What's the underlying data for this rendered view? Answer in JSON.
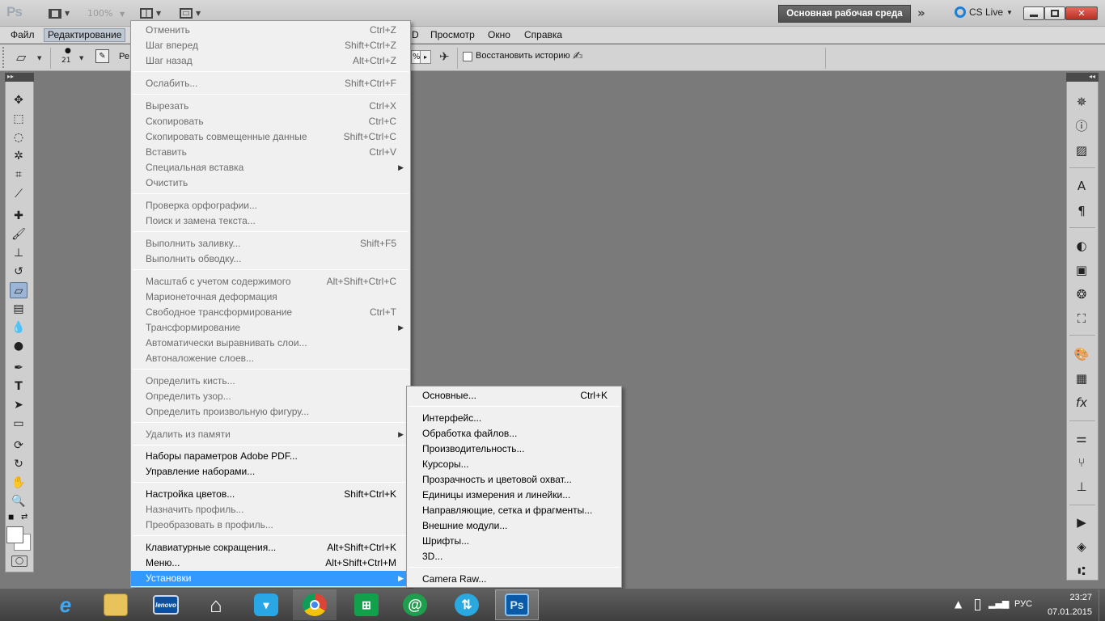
{
  "titlebar": {
    "app_logo": "Ps",
    "zoom": "100%",
    "workspace": "Основная рабочая среда",
    "more_workspaces": "»",
    "cs_live": "CS Live",
    "window_buttons": [
      "minimize-icon",
      "restore-icon",
      "close-icon"
    ]
  },
  "menubar": {
    "items": [
      "Файл",
      "Редактирование",
      "D",
      "Просмотр",
      "Окно",
      "Справка"
    ]
  },
  "options": {
    "brush_size": "21",
    "mode_prefix": "Ре",
    "percent_fragment": "%",
    "restore_history": "Восстановить историю"
  },
  "edit_menu": {
    "items": [
      {
        "label": "Отменить",
        "shortcut": "Ctrl+Z",
        "enabled": false
      },
      {
        "label": "Шаг вперед",
        "shortcut": "Shift+Ctrl+Z",
        "enabled": false
      },
      {
        "label": "Шаг назад",
        "shortcut": "Alt+Ctrl+Z",
        "enabled": false
      },
      {
        "label": "Ослабить...",
        "shortcut": "Shift+Ctrl+F",
        "enabled": false
      },
      {
        "label": "Вырезать",
        "shortcut": "Ctrl+X",
        "enabled": false
      },
      {
        "label": "Скопировать",
        "shortcut": "Ctrl+C",
        "enabled": false
      },
      {
        "label": "Скопировать совмещенные данные",
        "shortcut": "Shift+Ctrl+C",
        "enabled": false
      },
      {
        "label": "Вставить",
        "shortcut": "Ctrl+V",
        "enabled": false
      },
      {
        "label": "Специальная вставка",
        "shortcut": "",
        "enabled": false,
        "submenu": true
      },
      {
        "label": "Очистить",
        "shortcut": "",
        "enabled": false
      },
      {
        "label": "Проверка орфографии...",
        "shortcut": "",
        "enabled": false
      },
      {
        "label": "Поиск и замена текста...",
        "shortcut": "",
        "enabled": false
      },
      {
        "label": "Выполнить заливку...",
        "shortcut": "Shift+F5",
        "enabled": false
      },
      {
        "label": "Выполнить обводку...",
        "shortcut": "",
        "enabled": false
      },
      {
        "label": "Масштаб с учетом содержимого",
        "shortcut": "Alt+Shift+Ctrl+C",
        "enabled": false
      },
      {
        "label": "Марионеточная деформация",
        "shortcut": "",
        "enabled": false
      },
      {
        "label": "Свободное трансформирование",
        "shortcut": "Ctrl+T",
        "enabled": false
      },
      {
        "label": "Трансформирование",
        "shortcut": "",
        "enabled": false,
        "submenu": true
      },
      {
        "label": "Автоматически выравнивать слои...",
        "shortcut": "",
        "enabled": false
      },
      {
        "label": "Автоналожение слоев...",
        "shortcut": "",
        "enabled": false
      },
      {
        "label": "Определить кисть...",
        "shortcut": "",
        "enabled": false
      },
      {
        "label": "Определить узор...",
        "shortcut": "",
        "enabled": false
      },
      {
        "label": "Определить произвольную фигуру...",
        "shortcut": "",
        "enabled": false
      },
      {
        "label": "Удалить из памяти",
        "shortcut": "",
        "enabled": false,
        "submenu": true
      },
      {
        "label": "Наборы параметров Adobe PDF...",
        "shortcut": "",
        "enabled": true
      },
      {
        "label": "Управление наборами...",
        "shortcut": "",
        "enabled": true
      },
      {
        "label": "Настройка цветов...",
        "shortcut": "Shift+Ctrl+K",
        "enabled": true
      },
      {
        "label": "Назначить профиль...",
        "shortcut": "",
        "enabled": false
      },
      {
        "label": "Преобразовать в профиль...",
        "shortcut": "",
        "enabled": false
      },
      {
        "label": "Клавиатурные сокращения...",
        "shortcut": "Alt+Shift+Ctrl+K",
        "enabled": true
      },
      {
        "label": "Меню...",
        "shortcut": "Alt+Shift+Ctrl+M",
        "enabled": true
      },
      {
        "label": "Установки",
        "shortcut": "",
        "enabled": true,
        "submenu": true,
        "selected": true
      }
    ]
  },
  "prefs_submenu": {
    "items": [
      {
        "label": "Основные...",
        "shortcut": "Ctrl+K"
      },
      {
        "label": "Интерфейс...",
        "shortcut": ""
      },
      {
        "label": "Обработка файлов...",
        "shortcut": ""
      },
      {
        "label": "Производительность...",
        "shortcut": ""
      },
      {
        "label": "Курсоры...",
        "shortcut": ""
      },
      {
        "label": "Прозрачность и цветовой охват...",
        "shortcut": ""
      },
      {
        "label": "Единицы измерения и линейки...",
        "shortcut": ""
      },
      {
        "label": "Направляющие, сетка и фрагменты...",
        "shortcut": ""
      },
      {
        "label": "Внешние модули...",
        "shortcut": ""
      },
      {
        "label": "Шрифты...",
        "shortcut": ""
      },
      {
        "label": "3D...",
        "shortcut": ""
      },
      {
        "label": "Camera Raw...",
        "shortcut": ""
      }
    ]
  },
  "taskbar": {
    "apps": [
      "start-icon",
      "internet-explorer-icon",
      "file-explorer-icon",
      "lenovo-icon",
      "home-icon",
      "store-bag-icon",
      "chrome-icon",
      "windows-store-icon",
      "mail-agent-icon",
      "sync-icon",
      "photoshop-icon"
    ],
    "ps_label": "Ps",
    "lenovo_label": "lenovo",
    "language": "РУС",
    "time": "23:27",
    "date": "07.01.2015"
  },
  "colors": {
    "menu_highlight": "#3399ff",
    "workspace_bg": "#7a7a7a",
    "ps_blue": "#0b5aa8"
  }
}
